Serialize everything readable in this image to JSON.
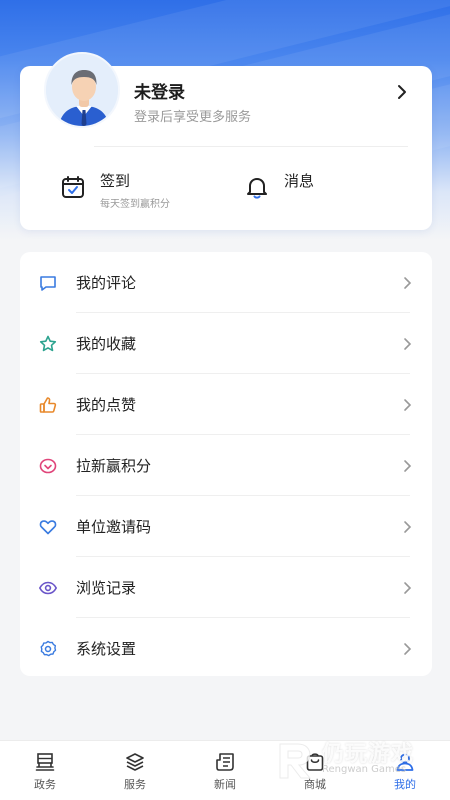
{
  "profile": {
    "title": "未登录",
    "subtitle": "登录后享受更多服务"
  },
  "quick_actions": {
    "checkin": {
      "title": "签到",
      "subtitle": "每天签到赢积分",
      "icon": "calendar-check-icon"
    },
    "message": {
      "title": "消息",
      "icon": "bell-icon"
    }
  },
  "menu": [
    {
      "label": "我的评论",
      "icon": "comment-icon",
      "color": "#3a7be0"
    },
    {
      "label": "我的收藏",
      "icon": "star-icon",
      "color": "#2ca38f"
    },
    {
      "label": "我的点赞",
      "icon": "thumbs-up-icon",
      "color": "#e8892b"
    },
    {
      "label": "拉新赢积分",
      "icon": "invite-points-icon",
      "color": "#e0457a"
    },
    {
      "label": "单位邀请码",
      "icon": "heart-icon",
      "color": "#3a7be0"
    },
    {
      "label": "浏览记录",
      "icon": "eye-icon",
      "color": "#6a55c9"
    },
    {
      "label": "系统设置",
      "icon": "gear-icon",
      "color": "#3a7be0"
    }
  ],
  "tabs": [
    {
      "label": "政务",
      "icon": "government-icon",
      "active": false
    },
    {
      "label": "服务",
      "icon": "layers-icon",
      "active": false
    },
    {
      "label": "新闻",
      "icon": "newspaper-icon",
      "active": false
    },
    {
      "label": "商城",
      "icon": "shop-icon",
      "active": false
    },
    {
      "label": "我的",
      "icon": "user-icon",
      "active": true
    }
  ],
  "colors": {
    "accent": "#2f6fe8",
    "text": "#222222",
    "muted": "#9a9a9a"
  },
  "watermark": {
    "text": "仍玩游戏",
    "subtext": "Rengwan Games"
  }
}
